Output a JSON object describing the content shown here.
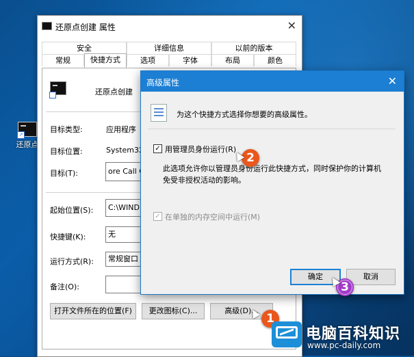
{
  "desktop": {
    "icon_label": "还原点"
  },
  "properties": {
    "title": "还原点创建 属性",
    "tabs_row1": [
      "安全",
      "详细信息",
      "以前的版本"
    ],
    "tabs_row2": [
      "常规",
      "快捷方式",
      "选项",
      "字体",
      "布局",
      "颜色"
    ],
    "shortcut_name": "还原点创建",
    "target_type_label": "目标类型:",
    "target_type_value": "应用程序",
    "target_location_label": "目标位置:",
    "target_location_value": "System32",
    "target_label": "目标(T):",
    "target_value": "ore Call C",
    "start_in_label": "起始位置(S):",
    "start_in_value": "C:\\WIND",
    "hotkey_label": "快捷键(K):",
    "hotkey_value": "无",
    "run_label": "运行方式(R):",
    "run_value": "常规窗口",
    "comment_label": "备注(O):",
    "comment_value": "",
    "btn_open_location": "打开文件所在的位置(F)",
    "btn_change_icon": "更改图标(C)...",
    "btn_advanced": "高级(D)..."
  },
  "advanced": {
    "title": "高级属性",
    "header_text": "为这个快捷方式选择你想要的高级属性。",
    "run_as_admin_label": "用管理员身份运行(R)",
    "run_as_admin_checked": "✓",
    "description_line1": "此选项允许你以管理员身份运行此快捷方式，同时保护你的计算机",
    "description_line2": "免受非授权活动的影响。",
    "separate_memory_label": "在单独的内存空间中运行(M)",
    "separate_memory_checked": "✓",
    "ok_label": "确定",
    "cancel_label": "取消"
  },
  "markers": [
    "1",
    "2",
    "3"
  ],
  "watermark": {
    "name": "电脑百科知识",
    "url": "www.pc-daily.com"
  }
}
